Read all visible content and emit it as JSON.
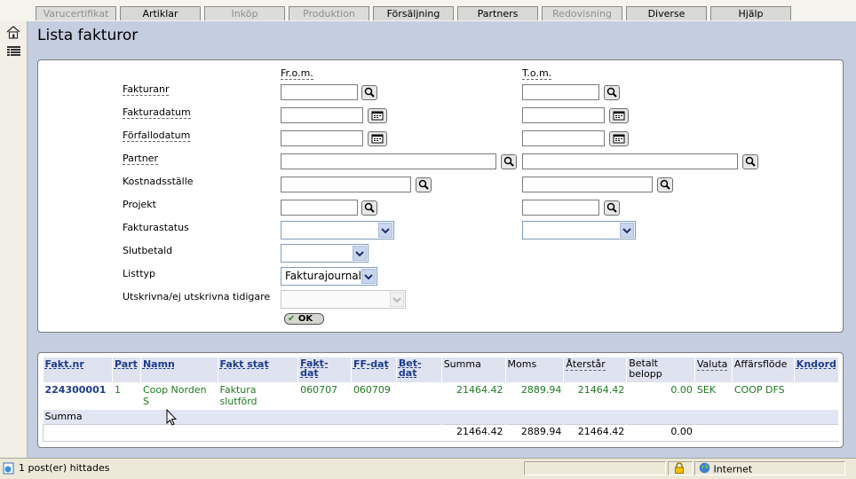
{
  "menu": {
    "tabs": [
      {
        "label": "Varucertifikat",
        "disabled": true
      },
      {
        "label": "Artiklar",
        "disabled": false
      },
      {
        "label": "Inköp",
        "disabled": true
      },
      {
        "label": "Produktion",
        "disabled": true
      },
      {
        "label": "Försäljning",
        "disabled": false
      },
      {
        "label": "Partners",
        "disabled": false
      },
      {
        "label": "Redovisning",
        "disabled": true
      },
      {
        "label": "Diverse",
        "disabled": false
      },
      {
        "label": "Hjälp",
        "disabled": false
      }
    ]
  },
  "sidebar": {
    "icons": [
      "home-icon",
      "list-icon"
    ]
  },
  "page": {
    "title": "Lista fakturor"
  },
  "filter": {
    "from_header": "Fr.o.m.",
    "to_header": "T.o.m.",
    "labels": {
      "fakturanr": "Fakturanr",
      "fakturadatum": "Fakturadatum",
      "forfallodatum": "Förfallodatum",
      "partner": "Partner",
      "kostnadsstalle": "Kostnadsställe",
      "projekt": "Projekt",
      "fakturastatus": "Fakturastatus",
      "slutbetald": "Slutbetald",
      "listtyp": "Listtyp",
      "utskrivna": "Utskrivna/ej utskrivna tidigare"
    },
    "listtyp_value": "Fakturajournal",
    "ok_label": "OK"
  },
  "results": {
    "headers": {
      "faktnr": "Fakt.nr",
      "part": "Part",
      "namn": "Namn",
      "faktstat": "Fakt stat",
      "faktdat_1": "Fakt-",
      "faktdat_2": "dat",
      "ffdat": "FF-dat",
      "betdat_1": "Bet-",
      "betdat_2": "dat",
      "summa": "Summa",
      "moms": "Moms",
      "aterstar": "Återstår",
      "betalt_1": "Betalt",
      "betalt_2": "belopp",
      "valuta": "Valuta",
      "affarsflode": "Affärsflöde",
      "kndord": "Kndord"
    },
    "row": {
      "faktnr": "224300001",
      "part": "1",
      "namn_1": "Coop Norden",
      "namn_2": "S",
      "faktstat_1": "Faktura",
      "faktstat_2": "slutförd",
      "faktdat": "060707",
      "ffdat": "060709",
      "betdat": "",
      "summa": "21464.42",
      "moms": "2889.94",
      "aterstar": "21464.42",
      "betalt": "0.00",
      "valuta": "SEK",
      "affarsflode": "COOP DFS",
      "kndord": ""
    },
    "summa_label": "Summa",
    "totals": {
      "summa": "21464.42",
      "moms": "2889.94",
      "aterstar": "21464.42",
      "betalt": "0.00"
    }
  },
  "statusbar": {
    "message": "1 post(er) hittades",
    "zone": "Internet"
  }
}
